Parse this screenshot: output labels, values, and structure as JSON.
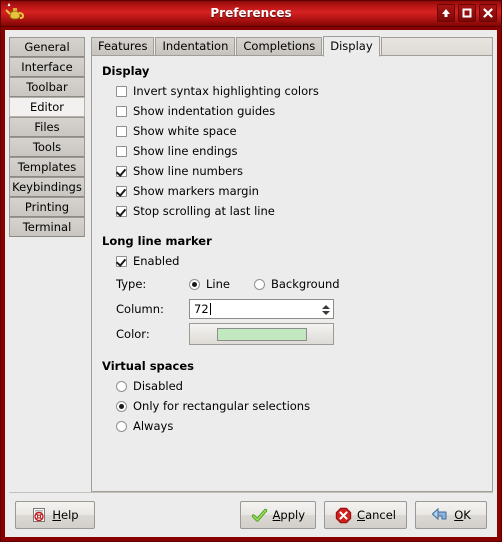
{
  "window": {
    "title": "Preferences",
    "icon": "geany-lamp-icon",
    "buttons": [
      {
        "name": "shade-button",
        "glyph": "arrow-up-icon"
      },
      {
        "name": "maximize-button",
        "glyph": "maximize-icon"
      },
      {
        "name": "close-button",
        "glyph": "close-icon"
      }
    ]
  },
  "sidebar": {
    "items": [
      {
        "label": "General",
        "selected": false
      },
      {
        "label": "Interface",
        "selected": false
      },
      {
        "label": "Toolbar",
        "selected": false
      },
      {
        "label": "Editor",
        "selected": true
      },
      {
        "label": "Files",
        "selected": false
      },
      {
        "label": "Tools",
        "selected": false
      },
      {
        "label": "Templates",
        "selected": false
      },
      {
        "label": "Keybindings",
        "selected": false
      },
      {
        "label": "Printing",
        "selected": false
      },
      {
        "label": "Terminal",
        "selected": false
      }
    ]
  },
  "tabs": [
    {
      "label": "Features",
      "active": false
    },
    {
      "label": "Indentation",
      "active": false
    },
    {
      "label": "Completions",
      "active": false
    },
    {
      "label": "Display",
      "active": true
    }
  ],
  "display_group": {
    "title": "Display",
    "checkboxes": [
      {
        "label": "Invert syntax highlighting colors",
        "checked": false
      },
      {
        "label": "Show indentation guides",
        "checked": false
      },
      {
        "label": "Show white space",
        "checked": false
      },
      {
        "label": "Show line endings",
        "checked": false
      },
      {
        "label": "Show line numbers",
        "checked": true
      },
      {
        "label": "Show markers margin",
        "checked": true
      },
      {
        "label": "Stop scrolling at last line",
        "checked": true
      }
    ]
  },
  "long_line_marker": {
    "title": "Long line marker",
    "enabled": {
      "label": "Enabled",
      "checked": true
    },
    "type": {
      "caption": "Type:",
      "options": [
        {
          "label": "Line",
          "selected": true
        },
        {
          "label": "Background",
          "selected": false
        }
      ]
    },
    "column": {
      "caption": "Column:",
      "value": "72"
    },
    "color": {
      "caption": "Color:",
      "swatch": "#c2e8bf"
    }
  },
  "virtual_spaces": {
    "title": "Virtual spaces",
    "options": [
      {
        "label": "Disabled",
        "selected": false
      },
      {
        "label": "Only for rectangular selections",
        "selected": true
      },
      {
        "label": "Always",
        "selected": false
      }
    ]
  },
  "actions": {
    "help": {
      "label": "Help",
      "mnemonic": "H",
      "icon": "help-document-icon"
    },
    "apply": {
      "label": "Apply",
      "mnemonic": "A",
      "icon": "check-mark-icon"
    },
    "cancel": {
      "label": "Cancel",
      "mnemonic": "C",
      "icon": "stop-cancel-icon"
    },
    "ok": {
      "label": "OK",
      "mnemonic": "O",
      "icon": "blue-arrow-icon"
    }
  }
}
